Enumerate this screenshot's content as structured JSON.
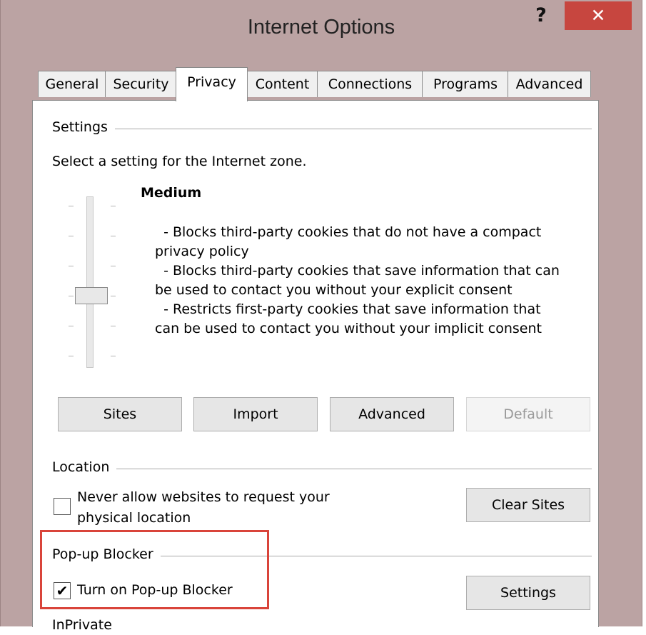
{
  "window": {
    "title": "Internet Options",
    "help_label": "?",
    "close_label": "✕"
  },
  "tabs": [
    {
      "label": "General",
      "active": false
    },
    {
      "label": "Security",
      "active": false
    },
    {
      "label": "Privacy",
      "active": true
    },
    {
      "label": "Content",
      "active": false
    },
    {
      "label": "Connections",
      "active": false
    },
    {
      "label": "Programs",
      "active": false
    },
    {
      "label": "Advanced",
      "active": false
    }
  ],
  "settings": {
    "group_label": "Settings",
    "instruction": "Select a setting for the Internet zone.",
    "level_title": "Medium",
    "description_lines": [
      "  - Blocks third-party cookies that do not have a compact",
      "privacy policy",
      "  - Blocks third-party cookies that save information that can",
      "be used to contact you without your explicit consent",
      "  - Restricts first-party cookies that save information that",
      "can be used to contact you without your implicit consent"
    ],
    "slider_levels": 6,
    "slider_level_index": 3,
    "buttons": {
      "sites": "Sites",
      "import": "Import",
      "advanced": "Advanced",
      "default": "Default"
    }
  },
  "location": {
    "group_label": "Location",
    "checkbox_label_line1": "Never allow websites to request your",
    "checkbox_label_line2": "physical location",
    "checked": false,
    "clear_sites": "Clear Sites"
  },
  "popup": {
    "group_label": "Pop-up Blocker",
    "checkbox_label": "Turn on Pop-up Blocker",
    "checked": true,
    "check_glyph": "✔",
    "settings_button": "Settings"
  },
  "inprivate": {
    "group_label": "InPrivate"
  },
  "colors": {
    "title_bar": "#bba3a3",
    "close_button": "#c7463f",
    "highlight": "#d9443a"
  }
}
